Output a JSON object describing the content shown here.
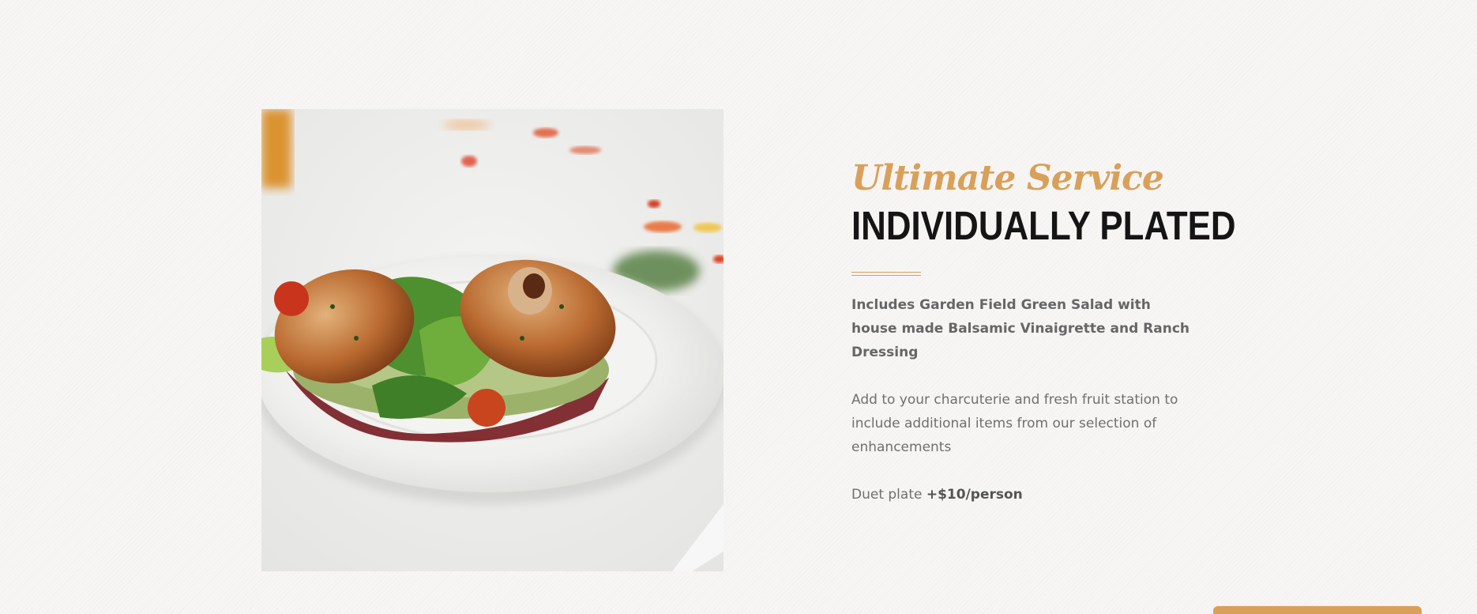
{
  "hero": {
    "script_title": "Ultimate Service",
    "main_title": "INDIVIDUALLY PLATED",
    "bold_description": "Includes Garden Field Green Salad with house made Balsamic Vinaigrette and Ranch Dressing",
    "description": "Add to your charcuterie and fresh fruit station to include additional items from our selection of enhancements",
    "price_prefix": "Duet plate",
    "price_value": "+$10/person"
  },
  "colors": {
    "accent": "#d9a05b",
    "title": "#151515",
    "body_text": "#6f6f6f",
    "background": "#f7f6f4"
  }
}
